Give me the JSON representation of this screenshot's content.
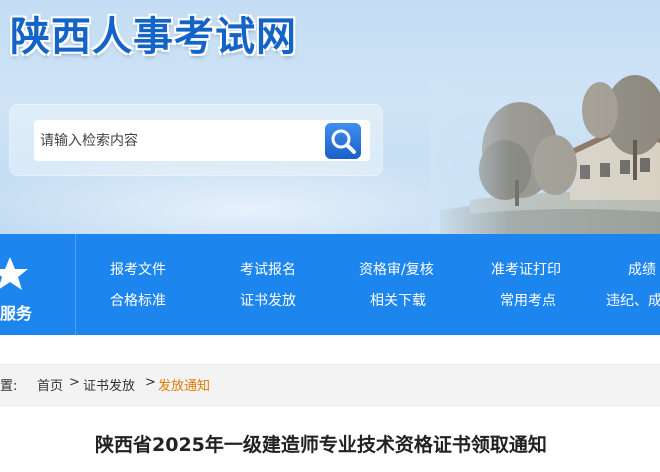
{
  "header": {
    "site_title": "陕西人事考试网",
    "search": {
      "placeholder": "请输入检索内容"
    }
  },
  "nav": {
    "service_label": "服务",
    "items": [
      {
        "label": "报考文件"
      },
      {
        "label": "考试报名"
      },
      {
        "label": "资格审/复核"
      },
      {
        "label": "准考证打印"
      },
      {
        "label": "成绩"
      },
      {
        "label": "合格标准"
      },
      {
        "label": "证书发放"
      },
      {
        "label": "相关下载"
      },
      {
        "label": "常用考点"
      },
      {
        "label": "违纪、成"
      }
    ]
  },
  "breadcrumb": {
    "prefix": "置:",
    "items": [
      "首页",
      "证书发放",
      "发放通知"
    ],
    "separator": ">"
  },
  "article": {
    "title": "陕西省2025年一级建造师专业技术资格证书领取通知"
  },
  "colors": {
    "brand_blue": "#1c86ee",
    "title_blue": "#1464c8",
    "breadcrumb_current": "#e07b00"
  },
  "icons": {
    "search_button": "search-icon",
    "service": "star-icon"
  }
}
